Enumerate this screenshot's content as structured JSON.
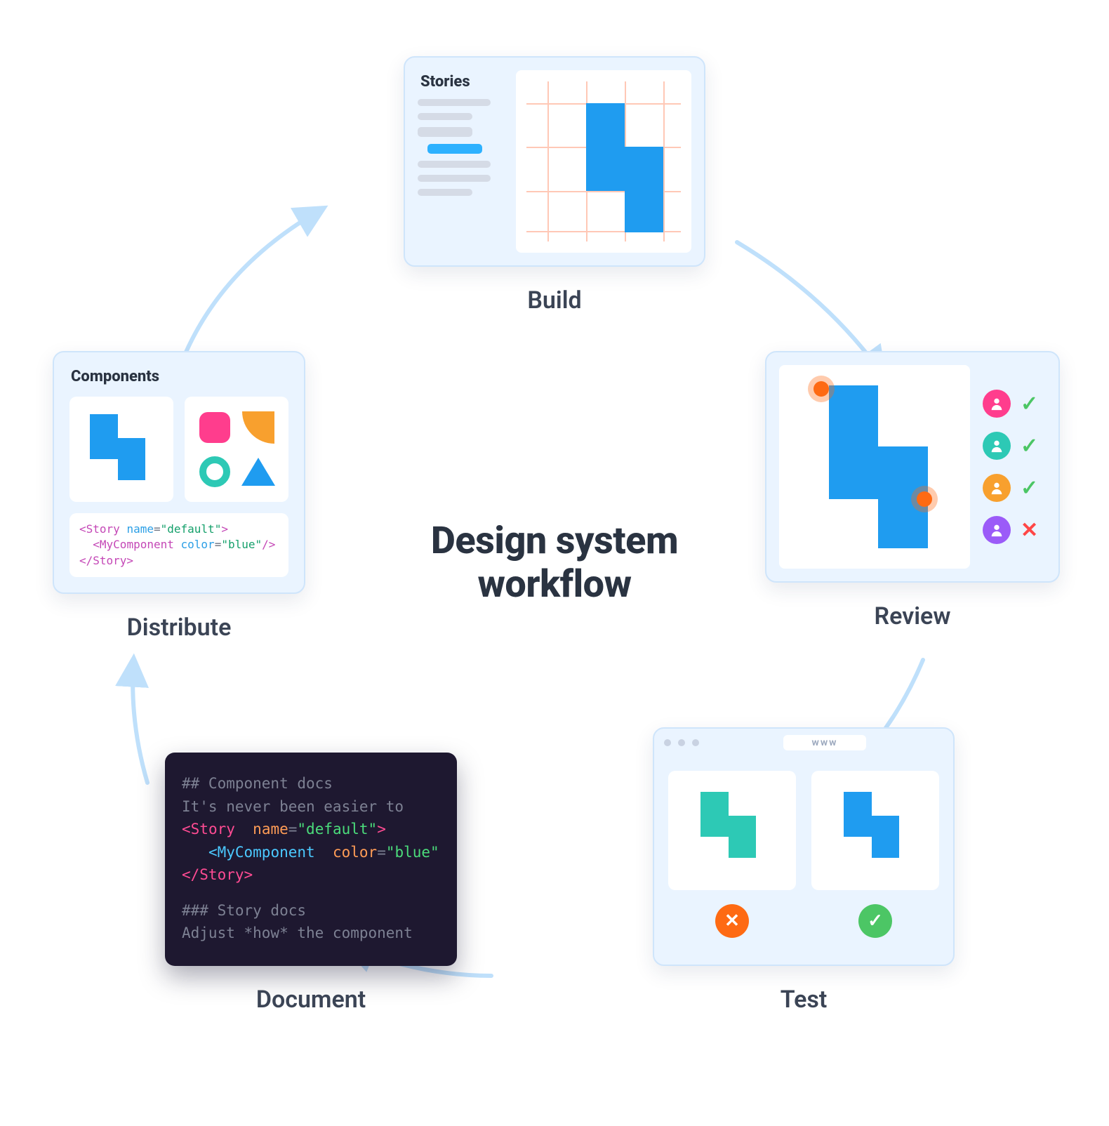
{
  "center": {
    "line1": "Design system",
    "line2": "workflow"
  },
  "nodes": {
    "build": {
      "label": "Build",
      "sidebar_title": "Stories"
    },
    "review": {
      "label": "Review",
      "reviewers": [
        {
          "color": "#ff3d8d",
          "status": "approve"
        },
        {
          "color": "#2dc9b5",
          "status": "approve"
        },
        {
          "color": "#f8a02e",
          "status": "approve"
        },
        {
          "color": "#9b5bf8",
          "status": "reject"
        }
      ]
    },
    "test": {
      "label": "Test",
      "address_bar": "www",
      "variants": [
        {
          "color": "#2dc9b5",
          "result": "fail"
        },
        {
          "color": "#1f9cf0",
          "result": "pass"
        }
      ]
    },
    "document": {
      "label": "Document",
      "heading1": "## Component docs",
      "intro": "It's never been easier to",
      "story_open_tag": "Story",
      "story_attr_name": "name",
      "story_attr_value": "\"default\"",
      "comp_tag": "MyComponent",
      "comp_attr_name": "color",
      "comp_attr_value": "\"blue\"",
      "story_close": "</Story>",
      "heading2": "### Story docs",
      "outro": "Adjust *how* the component"
    },
    "distribute": {
      "label": "Distribute",
      "heading": "Components",
      "snippet": {
        "open_tag": "Story",
        "open_attr": "name",
        "open_val": "\"default\"",
        "child_tag": "MyComponent",
        "child_attr": "color",
        "child_val": "\"blue\"",
        "close": "</Story>"
      }
    }
  }
}
